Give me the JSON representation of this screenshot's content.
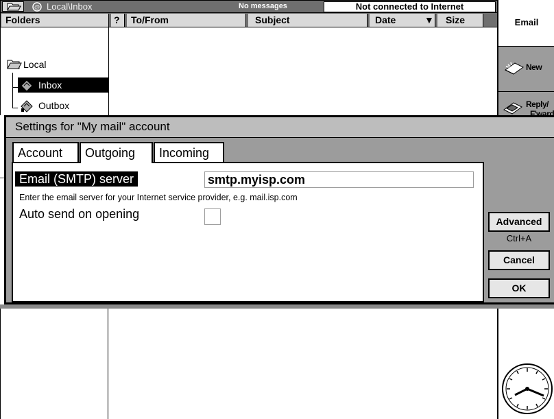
{
  "titlebar": {
    "location": "Local\\Inbox",
    "message_count": "No messages",
    "connection_status": "Not connected to Internet"
  },
  "columns": {
    "folders": "Folders",
    "question": "?",
    "to_from": "To/From",
    "subject": "Subject",
    "date": "Date",
    "date_sort_indicator": "▼",
    "size": "Size"
  },
  "folder_tree": {
    "local": "Local",
    "inbox": "Inbox",
    "outbox": "Outbox"
  },
  "toolbar": {
    "title": "Email",
    "new_label": "New",
    "reply_label_line1": "Reply/",
    "reply_label_line2": "F'ward"
  },
  "dialog": {
    "title": "Settings for \"My mail\" account",
    "tabs": [
      {
        "label": "Account",
        "active": false
      },
      {
        "label": "Outgoing",
        "active": true
      },
      {
        "label": "Incoming",
        "active": false
      }
    ],
    "smtp_label": "Email (SMTP) server",
    "smtp_value": "smtp.myisp.com",
    "smtp_hint": "Enter the email server for your Internet service provider, e.g. mail.isp.com",
    "autosend_label": "Auto send on opening",
    "autosend_checked": false,
    "advanced_label": "Advanced",
    "advanced_shortcut": "Ctrl+A",
    "cancel_label": "Cancel",
    "ok_label": "OK"
  },
  "icons": {
    "titlebar_folder": "open-folder-icon",
    "titlebar_app": "email-app-icon",
    "tree_local": "open-folder-icon",
    "tree_inbox": "mailbox-icon",
    "tree_outbox": "mailbox-icon",
    "toolbar_new": "new-mail-icon",
    "toolbar_reply": "reply-mail-icon",
    "clock": "analog-clock-icon"
  },
  "colors": {
    "titlebar_bg": "#6f6f6f",
    "dialog_bg": "#9c9c9c",
    "selection_bg": "#000000",
    "toolbar_button_bg": "#9c9c9c"
  }
}
